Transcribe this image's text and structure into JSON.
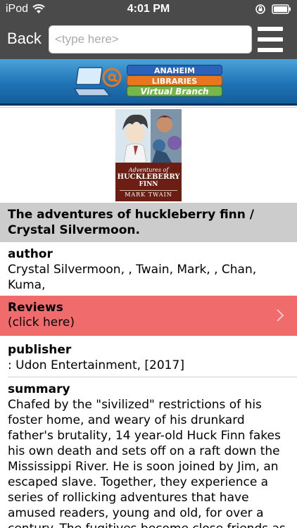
{
  "status_bar": {
    "carrier": "iPod",
    "time": "4:01 PM"
  },
  "nav": {
    "back_label": "Back",
    "search_placeholder": "<type here>"
  },
  "banner": {
    "line1": "ANAHEIM",
    "line2": "LIBRARIES",
    "line3": "Virtual Branch"
  },
  "cover": {
    "line1": "Adventures of",
    "line2": "HUCKLEBERRY",
    "line3": "FINN",
    "line4": "MARK TWAIN"
  },
  "record": {
    "title": "The adventures of huckleberry finn / Crystal Silvermoon.",
    "author_label": "author",
    "author_value": "Crystal Silvermoon,  , Twain, Mark, , Chan, Kuma,",
    "reviews_label": "Reviews",
    "reviews_hint": "(click here)",
    "publisher_label": "publisher",
    "publisher_value": ": Udon Entertainment, [2017]",
    "summary_label": "summary",
    "summary_value": "Chafed by the \"sivilized\" restrictions of his foster home, and weary of his drunkard father's brutality, 14 year-old Huck Finn fakes his own death and sets off on a raft down the Mississippi River. He is soon joined by Jim, an escaped slave. Together, they experience a series of rollicking adventures that have amused readers, young and old, for over a century. The fugitives become close friends as"
  },
  "colors": {
    "nav_bg": "#4a4a4a",
    "title_bg": "#cccccc",
    "reviews_bg": "#f06b6b"
  }
}
